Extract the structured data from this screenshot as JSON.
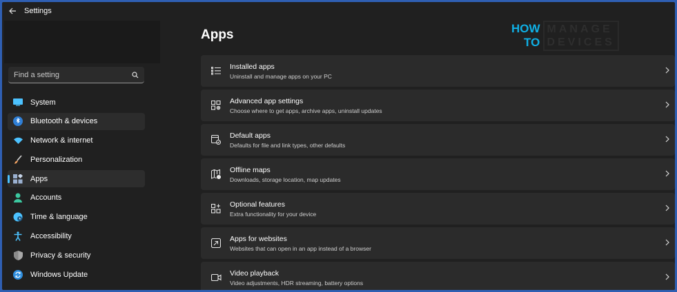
{
  "window": {
    "title": "Settings"
  },
  "search": {
    "placeholder": "Find a setting"
  },
  "sidebar": {
    "items": [
      {
        "label": "System",
        "icon": "system-icon",
        "color": "#4cc2ff"
      },
      {
        "label": "Bluetooth & devices",
        "icon": "bluetooth-icon",
        "color": "#4cc2ff"
      },
      {
        "label": "Network & internet",
        "icon": "wifi-icon",
        "color": "#4cc2ff"
      },
      {
        "label": "Personalization",
        "icon": "brush-icon",
        "color": "#f0a060"
      },
      {
        "label": "Apps",
        "icon": "apps-icon",
        "color": "#9ab0d0"
      },
      {
        "label": "Accounts",
        "icon": "person-icon",
        "color": "#3cc8a0"
      },
      {
        "label": "Time & language",
        "icon": "globe-clock-icon",
        "color": "#4cc2ff"
      },
      {
        "label": "Accessibility",
        "icon": "accessibility-icon",
        "color": "#4cc2ff"
      },
      {
        "label": "Privacy & security",
        "icon": "shield-icon",
        "color": "#a0a0a0"
      },
      {
        "label": "Windows Update",
        "icon": "update-icon",
        "color": "#4cc2ff"
      }
    ],
    "selected": "Apps"
  },
  "main": {
    "title": "Apps",
    "cards": [
      {
        "title": "Installed apps",
        "subtitle": "Uninstall and manage apps on your PC",
        "icon": "list-icon"
      },
      {
        "title": "Advanced app settings",
        "subtitle": "Choose where to get apps, archive apps, uninstall updates",
        "icon": "app-settings-icon"
      },
      {
        "title": "Default apps",
        "subtitle": "Defaults for file and link types, other defaults",
        "icon": "default-apps-icon"
      },
      {
        "title": "Offline maps",
        "subtitle": "Downloads, storage location, map updates",
        "icon": "map-icon"
      },
      {
        "title": "Optional features",
        "subtitle": "Extra functionality for your device",
        "icon": "add-feature-icon"
      },
      {
        "title": "Apps for websites",
        "subtitle": "Websites that can open in an app instead of a browser",
        "icon": "open-link-icon"
      },
      {
        "title": "Video playback",
        "subtitle": "Video adjustments, HDR streaming, battery options",
        "icon": "video-icon"
      }
    ]
  },
  "logo": {
    "line1": "HOW",
    "line2": "TO",
    "line3": "MANAGE",
    "line4": "DEVICES"
  }
}
